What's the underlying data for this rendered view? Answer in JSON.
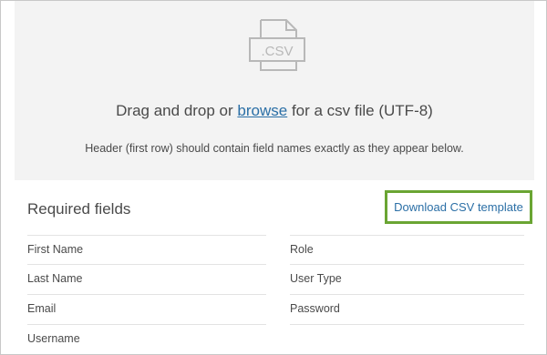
{
  "upload": {
    "icon_label": ".CSV",
    "drop_text_before": "Drag and drop or ",
    "browse_link": "browse",
    "drop_text_after": " for a csv file (UTF-8)",
    "hint": "Header (first row) should contain field names exactly as they appear below."
  },
  "required": {
    "title": "Required fields",
    "download_label": "Download CSV template",
    "left_fields": [
      "First Name",
      "Last Name",
      "Email",
      "Username"
    ],
    "right_fields": [
      "Role",
      "User Type",
      "Password"
    ]
  },
  "colors": {
    "link": "#2b6fa6",
    "highlight_border": "#6aa533",
    "dropzone_bg": "#f3f3f3"
  }
}
